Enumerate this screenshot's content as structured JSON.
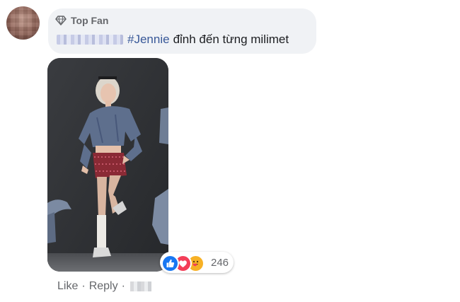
{
  "comment": {
    "badge": "Top Fan",
    "hashtag": "#Jennie",
    "text": "đỉnh đến từng milimet"
  },
  "reactions": {
    "types": [
      "like",
      "love",
      "care"
    ],
    "count": "246"
  },
  "actions": {
    "like_label": "Like",
    "reply_label": "Reply",
    "separator": "·"
  },
  "icons": {
    "badge": "diamond-icon",
    "like": "thumbs-up-icon",
    "love": "heart-icon",
    "care": "care-hug-icon"
  },
  "colors": {
    "bubble": "#f0f2f5",
    "hashtag": "#385898",
    "secondary_text": "#65676b",
    "like": "#1877f2",
    "love": "#f33e58",
    "care": "#f7b125"
  }
}
